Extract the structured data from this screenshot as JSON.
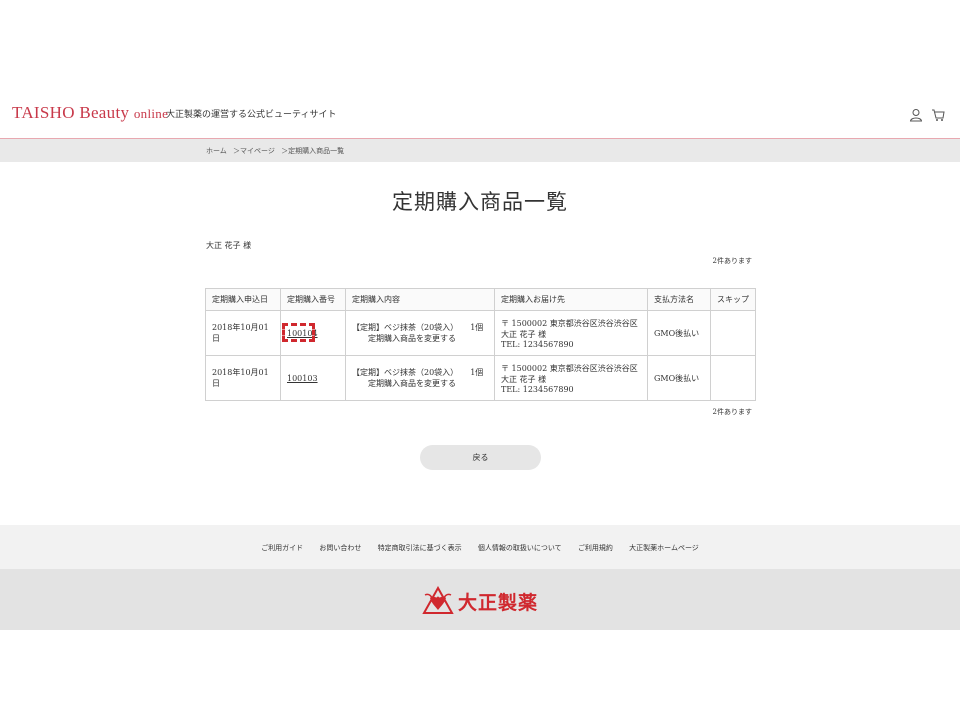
{
  "header": {
    "logo_main": "TAISHO Beauty",
    "logo_small": "online",
    "tagline": "大正製薬の運営する公式ビューティサイト",
    "icons": [
      "user-icon",
      "cart-icon"
    ]
  },
  "breadcrumb": [
    "ホーム",
    "＞マイページ",
    "＞定期購入商品一覧"
  ],
  "page_title": "定期購入商品一覧",
  "customer_name": "大正 花子 様",
  "count_label": "2件あります",
  "table": {
    "headers": [
      "定期購入申込日",
      "定期購入番号",
      "定期購入内容",
      "定期購入お届け先",
      "支払方法名",
      "スキップ"
    ],
    "rows": [
      {
        "date": "2018年10月01日",
        "number": "100104",
        "content_line1": "【定期】ベジ抹茶（20袋入）",
        "qty": "1個",
        "content_line2": "定期購入商品を変更する",
        "addr_line1": "〒 1500002 東京都渋谷区渋谷渋谷区",
        "addr_line2": "大正 花子 様",
        "addr_line3": "TEL: 1234567890",
        "payment": "GMO後払い",
        "skip": ""
      },
      {
        "date": "2018年10月01日",
        "number": "100103",
        "content_line1": "【定期】ベジ抹茶（20袋入）",
        "qty": "1個",
        "content_line2": "定期購入商品を変更する",
        "addr_line1": "〒 1500002 東京都渋谷区渋谷渋谷区",
        "addr_line2": "大正 花子 様",
        "addr_line3": "TEL: 1234567890",
        "payment": "GMO後払い",
        "skip": ""
      }
    ]
  },
  "back_button": "戻る",
  "footer_links": [
    "ご利用ガイド",
    "お問い合わせ",
    "特定商取引法に基づく表示",
    "個人情報の取扱いについて",
    "ご利用規約",
    "大正製薬ホームページ"
  ],
  "footer_brand": "大正製薬",
  "colors": {
    "brand_red": "#c8394a",
    "highlight_red": "#d0282e"
  }
}
